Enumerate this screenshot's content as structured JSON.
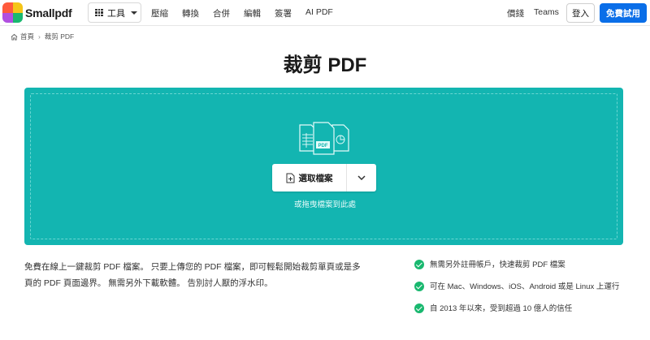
{
  "header": {
    "brand": "Smallpdf",
    "tools_label": "工具",
    "nav": [
      "壓縮",
      "轉換",
      "合併",
      "編輯",
      "簽署",
      "AI PDF"
    ],
    "pricing": "價錢",
    "teams": "Teams",
    "login": "登入",
    "trial": "免費試用"
  },
  "breadcrumb": {
    "home": "首頁",
    "current": "裁剪 PDF"
  },
  "title": "裁剪 PDF",
  "dropzone": {
    "choose_label": "選取檔案",
    "hint": "或拖曳檔案到此處"
  },
  "description": "免費在線上一鍵裁剪 PDF 檔案。 只要上傳您的 PDF 檔案，即可輕鬆開始裁剪單頁或是多頁的 PDF 頁面邊界。 無需另外下載軟體。 告別討人厭的浮水印。",
  "features": [
    "無需另外註冊帳戶，快速裁剪 PDF 檔案",
    "可在 Mac、Windows、iOS、Android 或是 Linux 上運行",
    "自 2013 年以來，受到超過 10 億人的信任"
  ],
  "colors": {
    "accent": "#0a6ee8",
    "dropzone": "#13b5b1",
    "check": "#19b86f"
  }
}
